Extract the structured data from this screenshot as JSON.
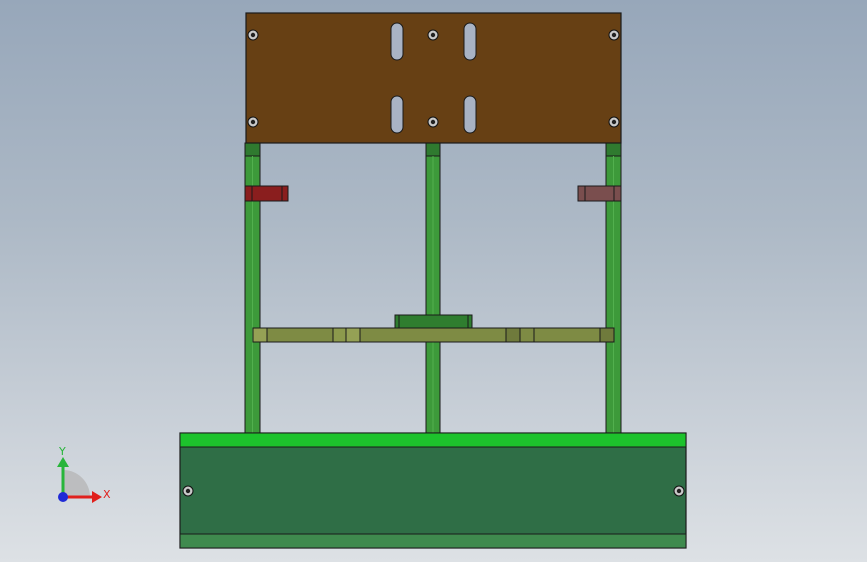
{
  "viewport": {
    "background_top": "#97a7ba",
    "background_bottom": "#dde1e5"
  },
  "model": {
    "colors": {
      "top_plate": "#674014",
      "frame_green": "#3d9a3a",
      "base_body": "#2f6e46",
      "base_strip": "#1dc22c",
      "crossbar": "#7e8b44",
      "center_block": "#2f7d2f",
      "bracket_left": "#8a1e1e",
      "bracket_right": "#7a4e4e",
      "slot": "#a9b3c4"
    },
    "parts": [
      "top-plate",
      "left-post",
      "center-post",
      "right-post",
      "left-bracket",
      "right-bracket",
      "crossbar",
      "center-block",
      "base-box"
    ]
  },
  "triad": {
    "x_label": "X",
    "y_label": "Y",
    "x_color": "#e0201c",
    "y_color": "#27b53a",
    "z_color": "#1f2ad6"
  }
}
